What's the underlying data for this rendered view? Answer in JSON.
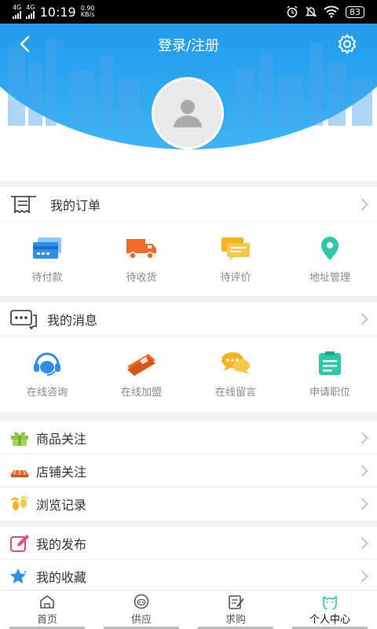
{
  "status_bar": {
    "net1": "4G",
    "net2": "4G",
    "time": "10:19",
    "speed_value": "0.90",
    "speed_unit": "KB/s",
    "battery": "83"
  },
  "header": {
    "title": "登录/注册"
  },
  "orders": {
    "title": "我的订单",
    "items": [
      {
        "label": "待付款",
        "icon": "wallet-card-icon",
        "color": "#2e8fe8"
      },
      {
        "label": "待收货",
        "icon": "delivery-truck-icon",
        "color": "#f06a2a"
      },
      {
        "label": "待评价",
        "icon": "comment-icon",
        "color": "#f5b41e"
      },
      {
        "label": "地址管理",
        "icon": "location-pin-icon",
        "color": "#2dc8a8"
      }
    ]
  },
  "messages": {
    "title": "我的消息",
    "items": [
      {
        "label": "在线咨询",
        "icon": "headset-icon",
        "color": "#2e8fe8"
      },
      {
        "label": "在线加盟",
        "icon": "join-ticket-icon",
        "color": "#f06a2a"
      },
      {
        "label": "在线留言",
        "icon": "chat-bubbles-icon",
        "color": "#f5b41e"
      },
      {
        "label": "申请职位",
        "icon": "clipboard-icon",
        "color": "#2dc8a8"
      }
    ]
  },
  "follow": {
    "rows": [
      {
        "label": "商品关注",
        "icon": "gift-icon"
      },
      {
        "label": "店铺关注",
        "icon": "shop-awning-icon"
      },
      {
        "label": "浏览记录",
        "icon": "footprints-icon"
      }
    ]
  },
  "mine": {
    "rows": [
      {
        "label": "我的发布",
        "icon": "edit-pencil-icon"
      },
      {
        "label": "我的收藏",
        "icon": "star-icon"
      }
    ]
  },
  "tabbar": {
    "tabs": [
      {
        "label": "首页",
        "icon": "home-icon"
      },
      {
        "label": "供应",
        "icon": "supply-icon"
      },
      {
        "label": "求购",
        "icon": "purchase-note-icon"
      },
      {
        "label": "个人中心",
        "icon": "profile-cat-icon"
      }
    ],
    "active": "个人中心"
  },
  "colors": {
    "header_blue": "#1e7fd8",
    "accent_cyan": "#2dc8a8"
  }
}
